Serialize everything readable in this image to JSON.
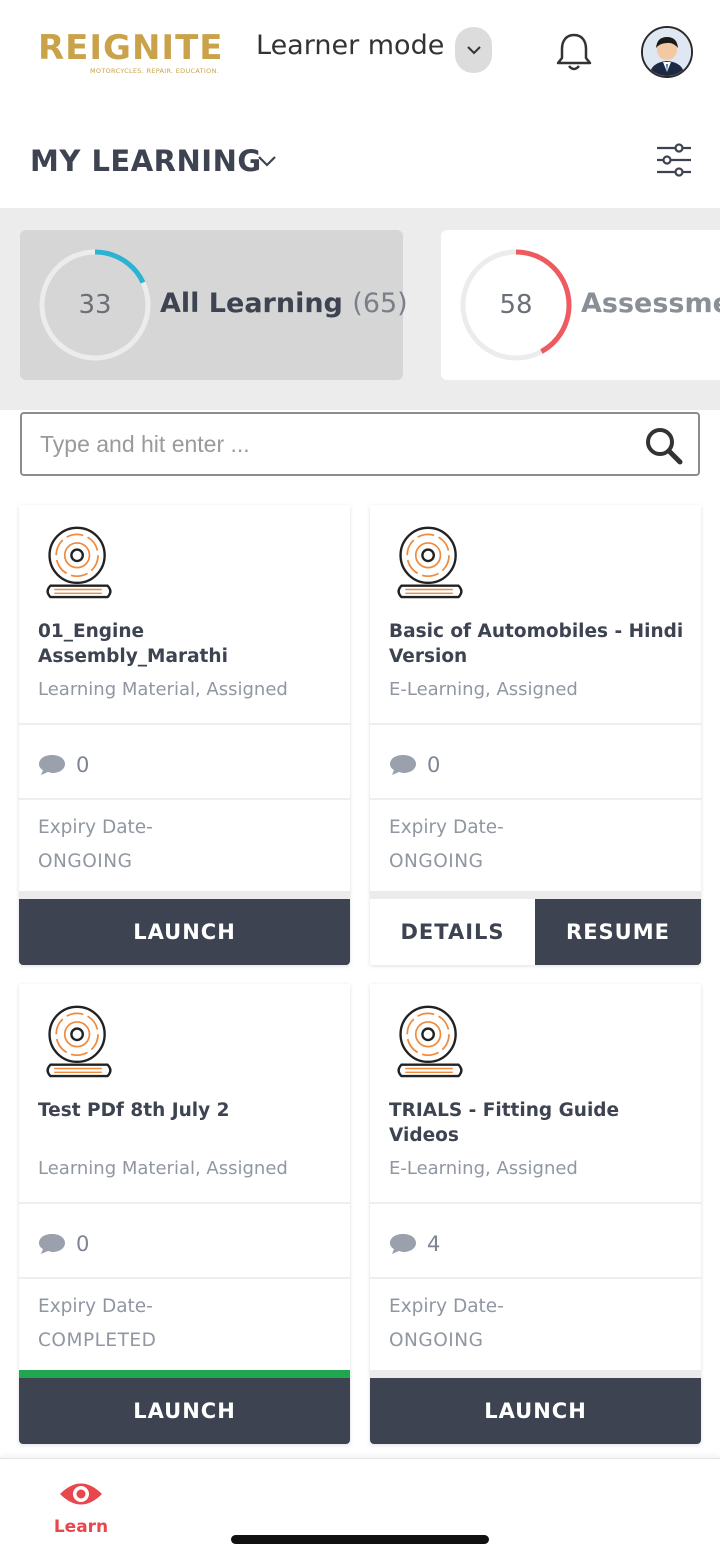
{
  "header": {
    "logo_text": "REIGNITE",
    "logo_tagline": "MOTORCYCLES. REPAIR. EDUCATION.",
    "mode_label": "Learner mode"
  },
  "page": {
    "title": "MY LEARNING"
  },
  "summary": [
    {
      "number": "33",
      "label": "All Learning",
      "count": "(65)",
      "progress": 0.18,
      "ring_color": "#2bb3d1"
    },
    {
      "number": "58",
      "label": "Assessme",
      "count": "",
      "progress": 0.42,
      "ring_color": "#ee5a5f"
    }
  ],
  "search": {
    "placeholder": "Type and hit enter ..."
  },
  "cards": [
    {
      "title": "01_Engine Assembly_Marathi",
      "meta": "Learning Material, Assigned",
      "comments": "0",
      "expiry_label": "Expiry Date-",
      "expiry_value": "ONGOING",
      "progress": 0,
      "buttons": [
        "LAUNCH"
      ]
    },
    {
      "title": "Basic of Automobiles - Hindi Version",
      "meta": "E-Learning, Assigned",
      "comments": "0",
      "expiry_label": "Expiry Date-",
      "expiry_value": "ONGOING",
      "progress": 0,
      "buttons": [
        "DETAILS",
        "RESUME"
      ]
    },
    {
      "title": "Test PDf 8th July 2",
      "meta": "Learning Material, Assigned",
      "comments": "0",
      "expiry_label": "Expiry Date-",
      "expiry_value": "COMPLETED",
      "progress": 1,
      "buttons": [
        "LAUNCH"
      ]
    },
    {
      "title": "TRIALS - Fitting Guide Videos",
      "meta": "E-Learning, Assigned",
      "comments": "4",
      "expiry_label": "Expiry Date-",
      "expiry_value": "ONGOING",
      "progress": 0,
      "buttons": [
        "LAUNCH"
      ]
    }
  ],
  "bottom_nav": {
    "learn_label": "Learn"
  },
  "colors": {
    "accent": "#e8474d",
    "button_dark": "#3d4351",
    "progress_complete": "#1fa64e",
    "logo_gold": "#c9a24a"
  }
}
